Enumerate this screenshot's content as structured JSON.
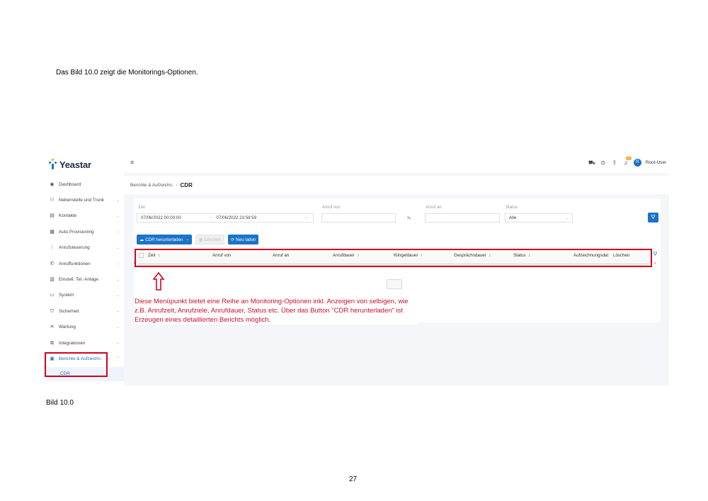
{
  "document": {
    "intro": "Das Bild 10.0 zeigt die Monitorings-Optionen.",
    "caption": "Bild 10.0",
    "page_number": "27"
  },
  "app": {
    "logo_text": "Yeastar",
    "brand_color": "#1a73c8"
  },
  "sidebar": {
    "items": [
      {
        "label": "Dashboard",
        "icon": "dashboard-icon",
        "glyph": "◉",
        "chevron": ""
      },
      {
        "label": "Nebenstelle und Trunk",
        "icon": "users-icon",
        "glyph": "⚇",
        "chevron": "⌄"
      },
      {
        "label": "Kontakte",
        "icon": "contacts-icon",
        "glyph": "▤",
        "chevron": "⌄"
      },
      {
        "label": "Auto Provisioning",
        "icon": "provisioning-icon",
        "glyph": "▦",
        "chevron": "⌄"
      },
      {
        "label": "Anrufsteuerung",
        "icon": "call-control-icon",
        "glyph": "⁞",
        "chevron": "⌄"
      },
      {
        "label": "Anruffunktionen",
        "icon": "phone-icon",
        "glyph": "✆",
        "chevron": "⌄"
      },
      {
        "label": "Einstell. Tel.-Anlage",
        "icon": "settings-icon",
        "glyph": "▥",
        "chevron": "⌄"
      },
      {
        "label": "System",
        "icon": "system-icon",
        "glyph": "▭",
        "chevron": "⌄"
      },
      {
        "label": "Sicherheit",
        "icon": "shield-icon",
        "glyph": "⛉",
        "chevron": "⌄"
      },
      {
        "label": "Wartung",
        "icon": "wrench-icon",
        "glyph": "✕",
        "chevron": "⌄"
      },
      {
        "label": "Integrationen",
        "icon": "integration-icon",
        "glyph": "⧉",
        "chevron": "⌄"
      },
      {
        "label": "Berichte & Aufzeichn.",
        "icon": "reports-icon",
        "glyph": "▣",
        "chevron": "⌃"
      }
    ],
    "sub_item": "CDR"
  },
  "topbar": {
    "menu_icon": "≡",
    "user_name": "Root-User",
    "avatar_letter": "R",
    "notification_count": "10"
  },
  "breadcrumb": {
    "parent": "Berichte & Aufzeichn.",
    "separator": "/",
    "current": "CDR"
  },
  "filters": {
    "time_label": "Zeit",
    "time_start": "07/06/2022 00:00:00",
    "time_separator": "~",
    "time_end": "07/06/2022 23:59:59",
    "call_from_label": "Anruf von",
    "call_from_value": "",
    "swap_glyph": "⇆",
    "call_to_label": "Anruf an",
    "call_to_value": "",
    "status_label": "Status",
    "status_value": "Alle"
  },
  "buttons": {
    "download": "CDR herunterladen",
    "delete": "Löschen",
    "reload": "Neu laden"
  },
  "table": {
    "columns": [
      "Zeit",
      "Anruf von",
      "Anruf an",
      "Anrufdauer",
      "Klingeldauer",
      "Gesprächsdauer",
      "Status",
      "Aufzeichnungsdat",
      "Löschen"
    ],
    "sortable": [
      true,
      false,
      false,
      true,
      true,
      true,
      true,
      false,
      false
    ]
  },
  "annotation": {
    "text": "Diese Menüpunkt bietet eine Reihe an Monitoring-Optionen inkl. Anzeigen von selbigen, wie z.B. Anrufzeit, Anrufziele, Anrufdauer, Status etc. Über das Button \"CDR herunterladen\" ist Erzeugen eines detaillierten Berichts möglich.",
    "color": "#d0021b"
  }
}
